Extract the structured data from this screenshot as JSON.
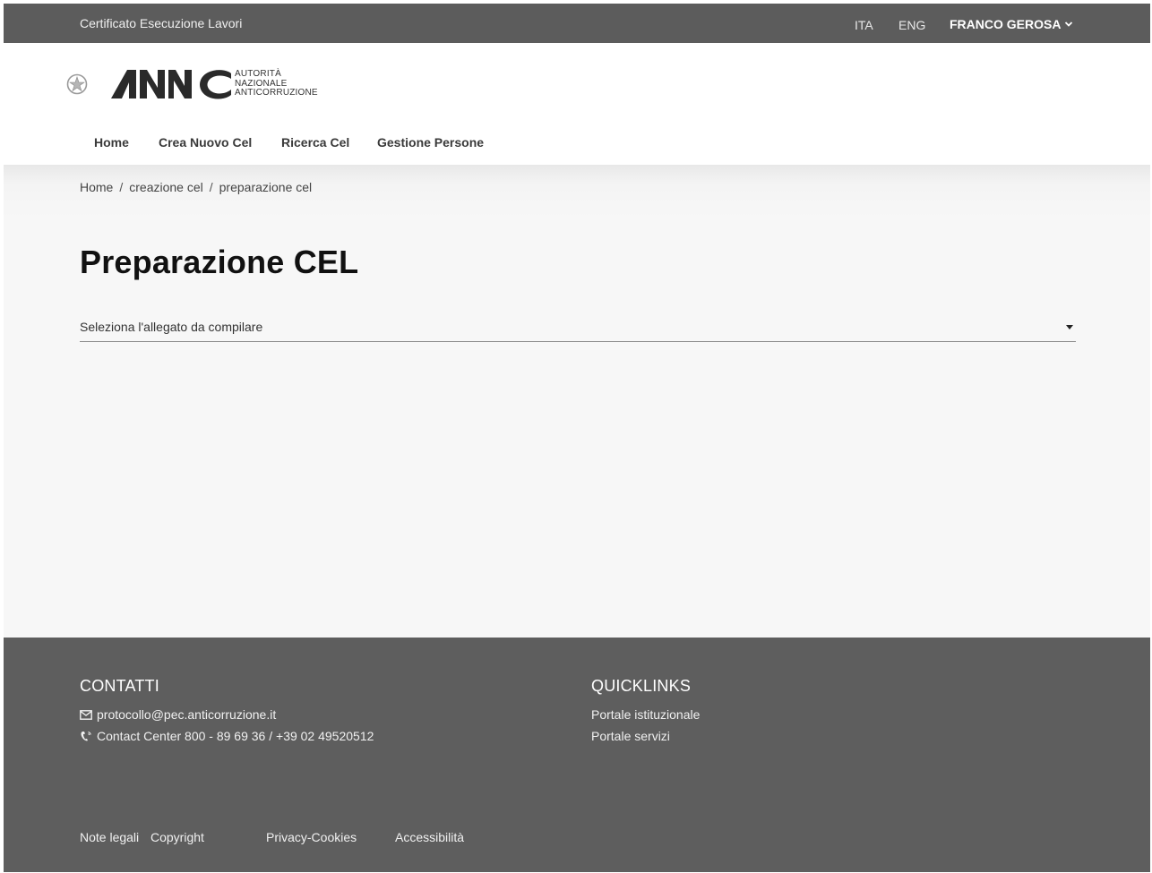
{
  "topbar": {
    "app_title": "Certificato Esecuzione Lavori",
    "languages": [
      "ITA",
      "ENG"
    ],
    "user_name": "FRANCO GEROSA"
  },
  "header": {
    "logo_mark": "ANAC",
    "logo_text": [
      "AUTORITÀ",
      "NAZIONALE",
      "ANTICORRUZIONE"
    ]
  },
  "nav": {
    "items": [
      {
        "label": "Home"
      },
      {
        "label": "Crea Nuovo Cel"
      },
      {
        "label": "Ricerca Cel"
      },
      {
        "label": "Gestione Persone"
      }
    ]
  },
  "breadcrumb": [
    "Home",
    "creazione cel",
    "preparazione cel"
  ],
  "main": {
    "title": "Preparazione CEL",
    "select_placeholder": "Seleziona l'allegato da compilare"
  },
  "footer": {
    "contacts_title": "CONTATTI",
    "email": "protocollo@pec.anticorruzione.it",
    "phone": "Contact Center 800 - 89 69 36 / +39 02 49520512",
    "quicklinks_title": "QUICKLINKS",
    "quicklinks": [
      "Portale istituzionale",
      "Portale servizi"
    ],
    "bottom_links": [
      "Note legali",
      "Copyright",
      "Privacy-Cookies",
      "Accessibilità"
    ]
  },
  "colors": {
    "topbar_bg": "#5c5c5c",
    "footer_bg": "#5e5e5e",
    "main_bg": "#f7f7f7"
  },
  "icons": [
    "emblem-icon",
    "chevron-down-icon",
    "caret-down-icon",
    "envelope-icon",
    "phone-icon"
  ]
}
